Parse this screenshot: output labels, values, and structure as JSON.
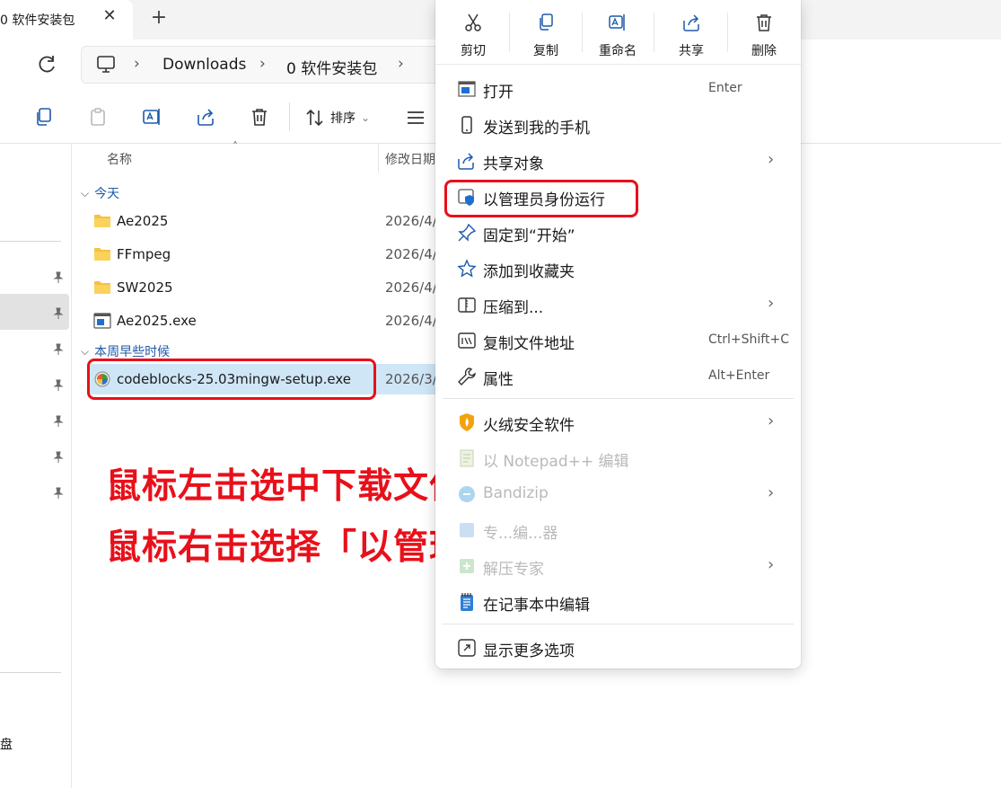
{
  "window": {
    "tab_title": "0 软件安装包",
    "tab_close": "✕",
    "new_tab": "+"
  },
  "breadcrumb": {
    "items": [
      "Downloads",
      "0 软件安装包"
    ],
    "separator": "›"
  },
  "toolbar": {
    "sort_label": "排序",
    "sort_caret": "⌄"
  },
  "file_list": {
    "columns": {
      "name": "名称",
      "modified": "修改日期"
    },
    "sort_caret": "˄",
    "groups": [
      {
        "label": "今天",
        "chevron": "⌵",
        "items": [
          {
            "name": "Ae2025",
            "date": "2026/4/",
            "type": "folder"
          },
          {
            "name": "FFmpeg",
            "date": "2026/4/",
            "type": "folder"
          },
          {
            "name": "SW2025",
            "date": "2026/4/",
            "type": "folder"
          },
          {
            "name": "Ae2025.exe",
            "date": "2026/4/",
            "type": "exe"
          }
        ]
      },
      {
        "label": "本周早些时候",
        "chevron": "⌵",
        "items": [
          {
            "name": "codeblocks-25.03mingw-setup.exe",
            "date": "2026/3/",
            "type": "installer",
            "selected": true
          }
        ]
      }
    ]
  },
  "sidebar": {
    "disk_label": "盘"
  },
  "annotation": {
    "line1": "鼠标左击选中下载文件",
    "line2": "鼠标右击选择「以管理员身份运行」"
  },
  "context_menu": {
    "actions": [
      {
        "label": "剪切"
      },
      {
        "label": "复制"
      },
      {
        "label": "重命名"
      },
      {
        "label": "共享"
      },
      {
        "label": "删除"
      }
    ],
    "items": [
      {
        "label": "打开",
        "shortcut": "Enter"
      },
      {
        "label": "发送到我的手机"
      },
      {
        "label": "共享对象",
        "submenu": "›"
      },
      {
        "label": "以管理员身份运行"
      },
      {
        "label": "固定到“开始”"
      },
      {
        "label": "添加到收藏夹"
      },
      {
        "label": "压缩到...",
        "submenu": "›"
      },
      {
        "label": "复制文件地址",
        "shortcut": "Ctrl+Shift+C"
      },
      {
        "label": "属性",
        "shortcut": "Alt+Enter"
      },
      {
        "label": "火绒安全软件",
        "submenu": "›"
      },
      {
        "label": "以 Notepad++ 编辑"
      },
      {
        "label": "Bandizip",
        "submenu": "›"
      },
      {
        "label": "专...编...器"
      },
      {
        "label": "解压专家",
        "submenu": "›"
      },
      {
        "label": "在记事本中编辑"
      },
      {
        "label": "显示更多选项"
      }
    ]
  },
  "colors": {
    "highlight_red": "#e8101a",
    "selection_blue": "#cfe6f7",
    "group_blue": "#1e5aa8",
    "folder_yellow": "#f6c143"
  }
}
